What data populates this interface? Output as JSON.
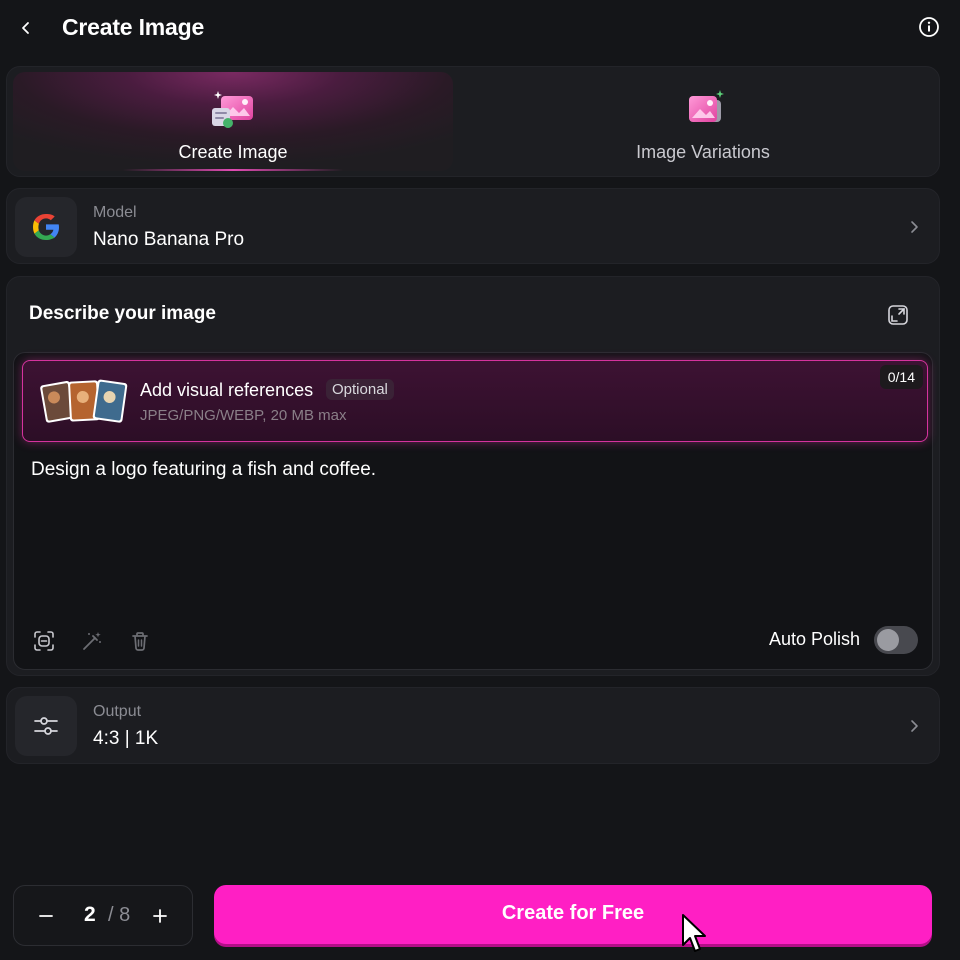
{
  "header": {
    "title": "Create Image"
  },
  "mode_tabs": [
    {
      "label": "Create Image",
      "active": true
    },
    {
      "label": "Image Variations",
      "active": false
    }
  ],
  "model": {
    "caption": "Model",
    "value": "Nano Banana Pro"
  },
  "describe": {
    "title": "Describe your image",
    "references": {
      "title": "Add visual references",
      "badge": "Optional",
      "subtitle": "JPEG/PNG/WEBP, 20 MB max",
      "count": "0/14"
    },
    "prompt": "Design a logo featuring a fish and coffee.",
    "auto_polish_label": "Auto Polish",
    "auto_polish_on": false
  },
  "output": {
    "caption": "Output",
    "value": "4:3 | 1K"
  },
  "stepper": {
    "value": "2",
    "max": "/ 8"
  },
  "create_button": {
    "label": "Create for Free"
  },
  "colors": {
    "accent": "#ff1fc4",
    "background": "#141518",
    "card": "#1c1d21"
  }
}
